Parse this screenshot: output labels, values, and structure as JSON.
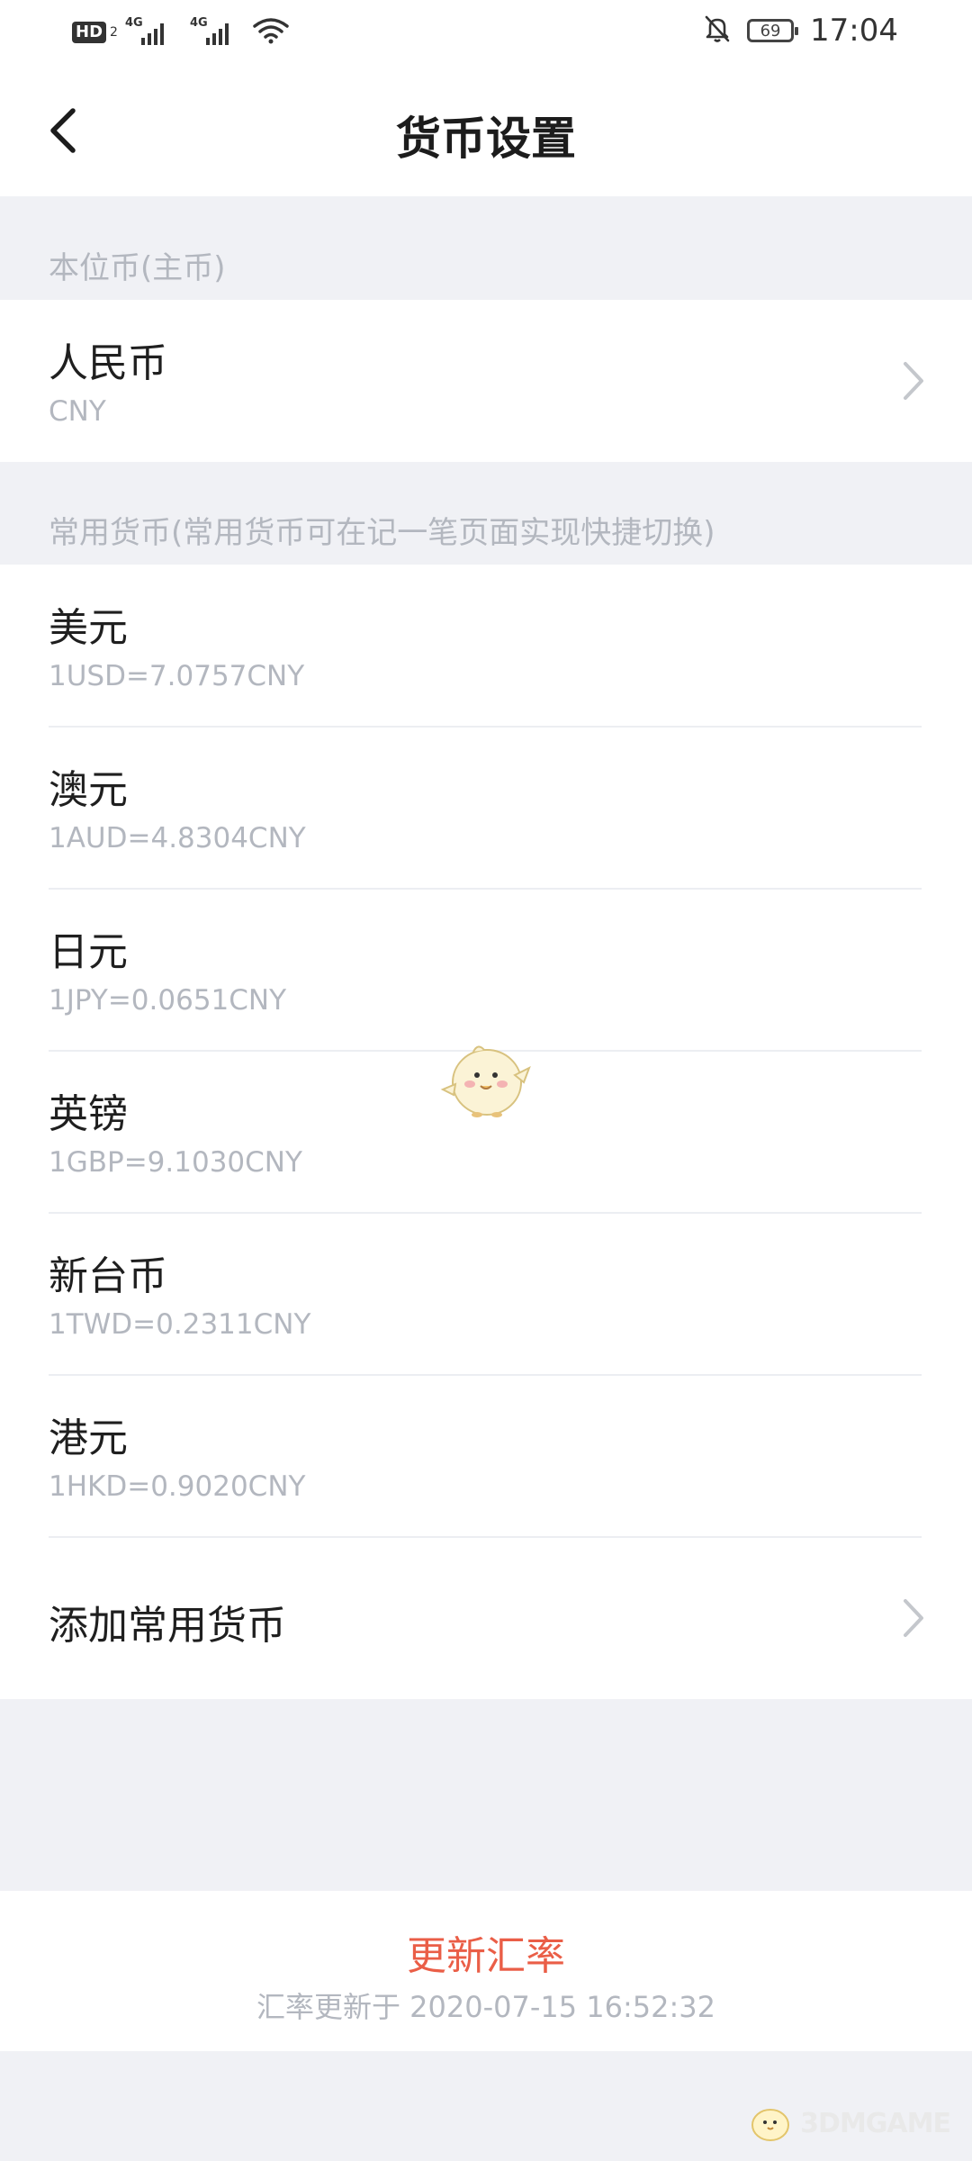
{
  "status_bar": {
    "hd_label": "HD",
    "hd_sub": "2",
    "signal1_label": "4G",
    "signal2_label": "4G",
    "battery": "69",
    "time": "17:04"
  },
  "header": {
    "title": "货币设置"
  },
  "base_section": {
    "label": "本位币(主币)",
    "currency_name": "人民币",
    "currency_code": "CNY"
  },
  "common_section": {
    "label": "常用货币(常用货币可在记一笔页面实现快捷切换)",
    "items": [
      {
        "name": "美元",
        "rate": "1USD=7.0757CNY"
      },
      {
        "name": "澳元",
        "rate": "1AUD=4.8304CNY"
      },
      {
        "name": "日元",
        "rate": "1JPY=0.0651CNY"
      },
      {
        "name": "英镑",
        "rate": "1GBP=9.1030CNY"
      },
      {
        "name": "新台币",
        "rate": "1TWD=0.2311CNY"
      },
      {
        "name": "港元",
        "rate": "1HKD=0.9020CNY"
      }
    ],
    "add_label": "添加常用货币"
  },
  "update": {
    "button_label": "更新汇率",
    "time_text": "汇率更新于 2020-07-15 16:52:32"
  },
  "watermark": {
    "text": "3DMGAME"
  },
  "colors": {
    "accent_red": "#ea5e47",
    "background": "#f0f1f5",
    "secondary_text": "#b3b7bf"
  }
}
